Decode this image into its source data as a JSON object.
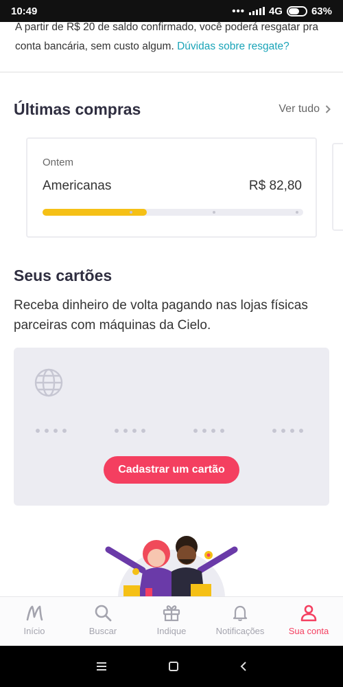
{
  "status_bar": {
    "time": "10:49",
    "network": "4G",
    "battery": "63%",
    "battery_level": 0.63
  },
  "cashback": {
    "info_text": "A partir de  R$ 20  de saldo confirmado, você poderá resgatar pra conta bancária, sem custo algum.",
    "link_text": "Dúvidas sobre resgate?"
  },
  "purchases": {
    "title": "Últimas compras",
    "see_all": "Ver tudo",
    "items": [
      {
        "date": "Ontem",
        "store": "Americanas",
        "amount": "R$ 82,80",
        "progress": 0.4
      }
    ]
  },
  "cards": {
    "title": "Seus cartões",
    "description": "Receba dinheiro de volta pagando nas lojas físicas parceiras com máquinas da Cielo.",
    "register_button": "Cadastrar um cartão"
  },
  "bottom_nav": {
    "items": [
      {
        "label": "Início",
        "icon": "meliuz-logo-icon"
      },
      {
        "label": "Buscar",
        "icon": "search-icon"
      },
      {
        "label": "Indique",
        "icon": "gift-icon"
      },
      {
        "label": "Notificações",
        "icon": "bell-icon"
      },
      {
        "label": "Sua conta",
        "icon": "user-icon",
        "active": true
      }
    ]
  },
  "colors": {
    "accent": "#f43f60",
    "link": "#1aa4b8",
    "progress": "#f5c016",
    "card_panel": "#ececf2"
  }
}
